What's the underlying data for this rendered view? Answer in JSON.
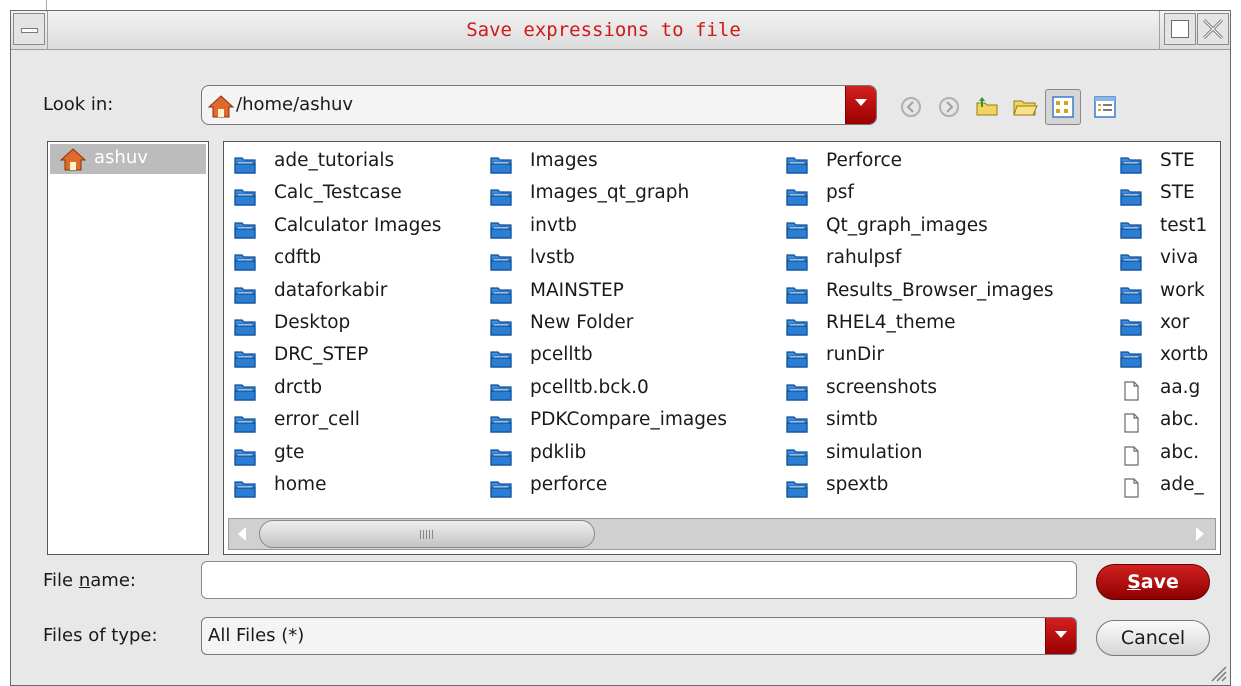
{
  "dialog": {
    "title": "Save expressions to file"
  },
  "look_in": {
    "label": "Look in:",
    "path": "/home/ashuv"
  },
  "toolbar": {
    "icons": [
      "back-icon",
      "forward-icon",
      "parent-folder-icon",
      "new-folder-icon",
      "list-view-icon",
      "detail-view-icon"
    ]
  },
  "sidebar": {
    "items": [
      {
        "label": "ashuv",
        "icon": "home-icon"
      }
    ]
  },
  "files": {
    "columns": [
      [
        "ade_tutorials",
        "Calc_Testcase",
        "Calculator Images",
        "cdftb",
        "dataforkabir",
        "Desktop",
        "DRC_STEP",
        "drctb",
        "error_cell",
        "gte",
        "home"
      ],
      [
        "Images",
        "Images_qt_graph",
        "invtb",
        "lvstb",
        "MAINSTEP",
        "New Folder",
        "pcelltb",
        "pcelltb.bck.0",
        "PDKCompare_images",
        "pdklib",
        "perforce"
      ],
      [
        "Perforce",
        "psf",
        "Qt_graph_images",
        "rahulpsf",
        "Results_Browser_images",
        "RHEL4_theme",
        "runDir",
        "screenshots",
        "simtb",
        "simulation",
        "spextb"
      ],
      [
        "STE",
        "STE",
        "test1",
        "viva",
        "work",
        "xor",
        "xortb",
        "aa.g",
        "abc.",
        "abc.",
        "ade_"
      ]
    ],
    "column4_types": [
      "folder",
      "folder",
      "folder",
      "folder",
      "folder",
      "folder",
      "folder",
      "file",
      "file",
      "file",
      "file"
    ]
  },
  "file_name": {
    "label_pre": "File ",
    "label_u": "n",
    "label_post": "ame:",
    "value": ""
  },
  "file_type": {
    "label": "Files of type:",
    "value": "All Files (*)"
  },
  "buttons": {
    "save_u": "S",
    "save_rest": "ave",
    "cancel": "Cancel"
  },
  "colors": {
    "title_text": "#d01818",
    "accent_red": "#c41010",
    "folder_blue": "#2a7fd4"
  }
}
